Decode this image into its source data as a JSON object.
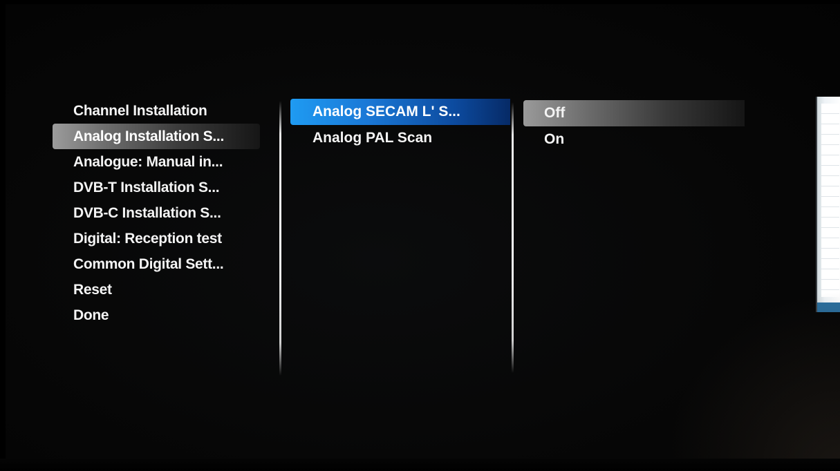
{
  "menu_level1": {
    "items": [
      {
        "label": "Channel Installation"
      },
      {
        "label": "Analog Installation S..."
      },
      {
        "label": "Analogue: Manual in..."
      },
      {
        "label": "DVB-T Installation S..."
      },
      {
        "label": "DVB-C Installation S..."
      },
      {
        "label": "Digital: Reception test"
      },
      {
        "label": "Common Digital Sett..."
      },
      {
        "label": "Reset"
      },
      {
        "label": "Done"
      }
    ],
    "selected_index": 1
  },
  "menu_level2": {
    "items": [
      {
        "label": "Analog SECAM L' S..."
      },
      {
        "label": "Analog PAL Scan"
      }
    ],
    "selected_index": 0
  },
  "menu_level3": {
    "items": [
      {
        "label": "Off"
      },
      {
        "label": "On"
      }
    ],
    "selected_index": 0
  },
  "colors": {
    "focus_highlight": "#1a78d6",
    "selection_highlight": "#8a8a8a",
    "text": "#f4f4f4",
    "background": "#070707"
  }
}
